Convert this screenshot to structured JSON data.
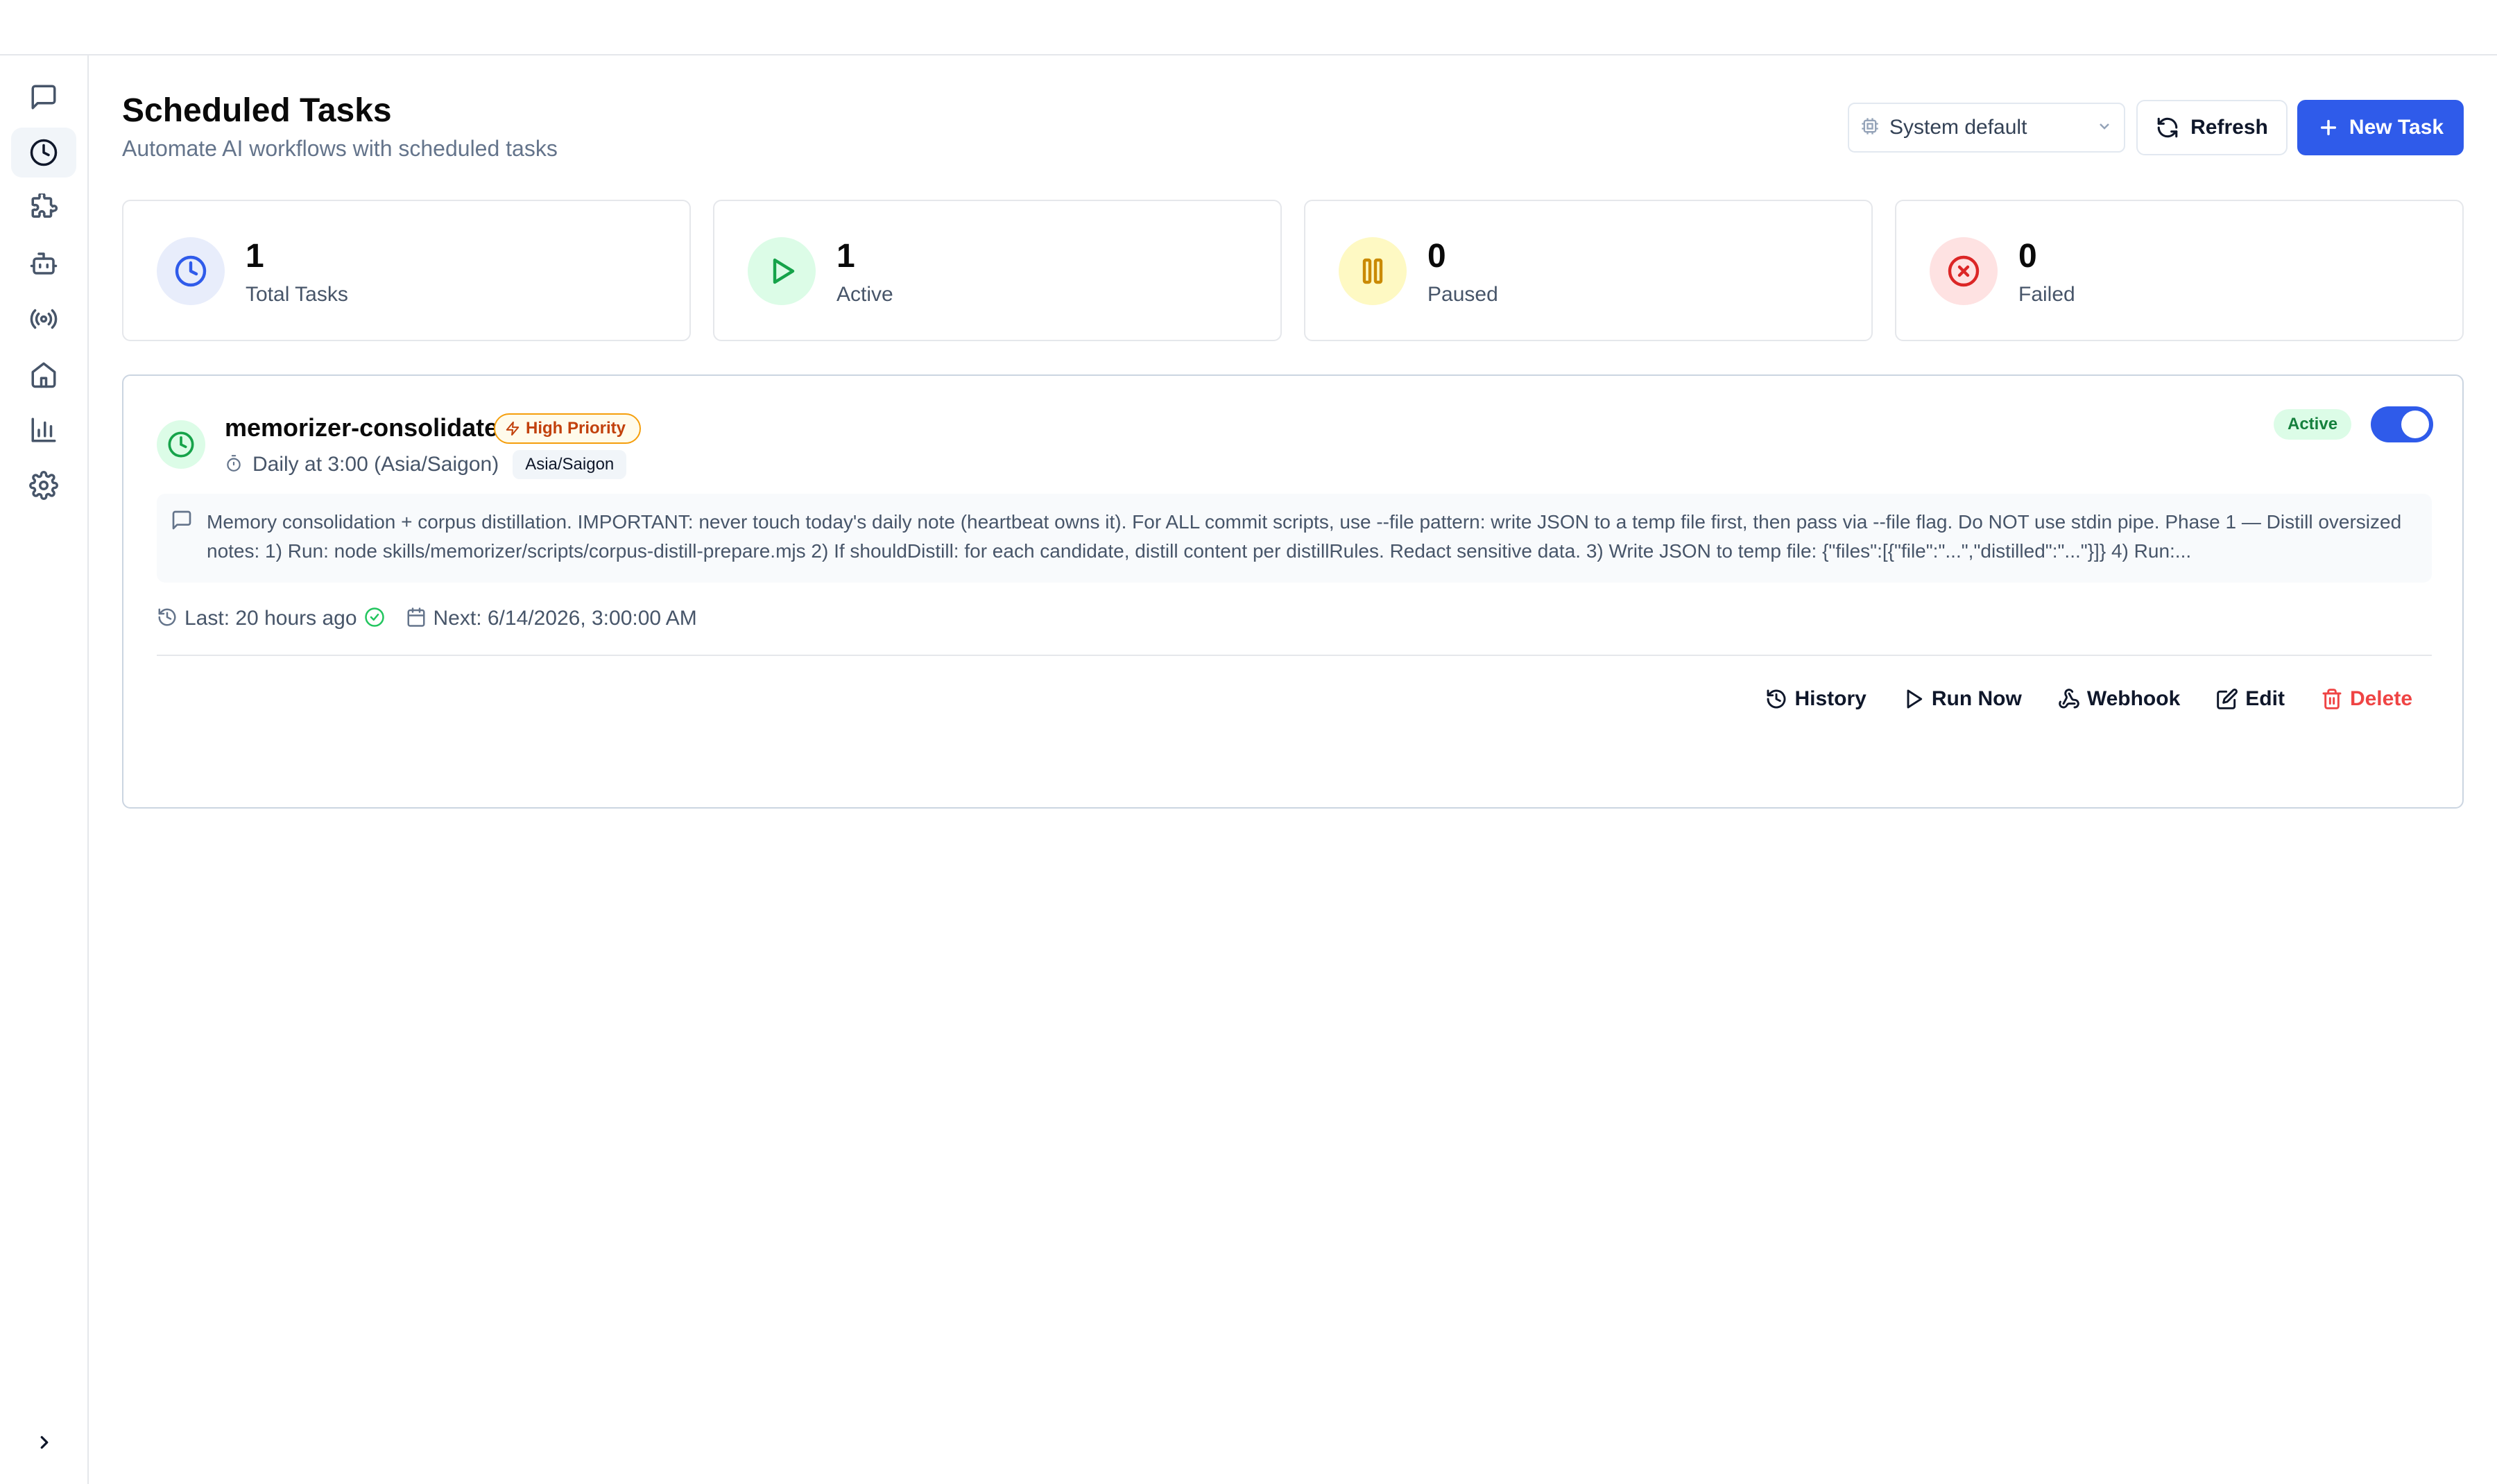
{
  "header": {
    "title": "Scheduled Tasks",
    "subtitle": "Automate AI workflows with scheduled tasks",
    "timezone_select": "System default",
    "refresh_label": "Refresh",
    "new_task_label": "New Task"
  },
  "sidebar": {
    "items": [
      {
        "name": "chat",
        "icon": "message-square-icon",
        "active": false
      },
      {
        "name": "scheduled-tasks",
        "icon": "clock-icon",
        "active": true
      },
      {
        "name": "plugins",
        "icon": "puzzle-icon",
        "active": false
      },
      {
        "name": "agents",
        "icon": "bot-icon",
        "active": false
      },
      {
        "name": "broadcast",
        "icon": "radio-icon",
        "active": false
      },
      {
        "name": "home",
        "icon": "home-icon",
        "active": false
      },
      {
        "name": "analytics",
        "icon": "bar-chart-icon",
        "active": false
      },
      {
        "name": "settings",
        "icon": "gear-icon",
        "active": false
      }
    ]
  },
  "stats": [
    {
      "value": "1",
      "label": "Total Tasks",
      "icon": "clock-icon",
      "color": "#2f5bea",
      "bg": "#e8edfb"
    },
    {
      "value": "1",
      "label": "Active",
      "icon": "play-icon",
      "color": "#16a34a",
      "bg": "#dcfce7"
    },
    {
      "value": "0",
      "label": "Paused",
      "icon": "pause-icon",
      "color": "#ca8a04",
      "bg": "#fef9c3"
    },
    {
      "value": "0",
      "label": "Failed",
      "icon": "x-circle-icon",
      "color": "#dc2626",
      "bg": "#fee2e2"
    }
  ],
  "task": {
    "name": "memorizer-consolidate",
    "priority": "High Priority",
    "schedule": "Daily at 3:00 (Asia/Saigon)",
    "timezone": "Asia/Saigon",
    "status": "Active",
    "enabled": true,
    "description": "Memory consolidation + corpus distillation. IMPORTANT: never touch today's daily note (heartbeat owns it). For ALL commit scripts, use --file pattern: write JSON to a temp file first, then pass via --file flag. Do NOT use stdin pipe. Phase 1 — Distill oversized notes: 1) Run: node skills/memorizer/scripts/corpus-distill-prepare.mjs 2) If shouldDistill: for each candidate, distill content per distillRules. Redact sensitive data. 3) Write JSON to temp file: {\"files\":[{\"file\":\"...\",\"distilled\":\"...\"}]} 4) Run:...",
    "last_run": "Last: 20 hours ago",
    "next_run": "Next: 6/14/2026, 3:00:00 AM",
    "actions": {
      "history": "History",
      "run_now": "Run Now",
      "webhook": "Webhook",
      "edit": "Edit",
      "delete": "Delete"
    }
  },
  "colors": {
    "primary": "#2f5bea",
    "success": "#16a34a",
    "warning": "#f59e0b",
    "danger": "#ef4444"
  }
}
